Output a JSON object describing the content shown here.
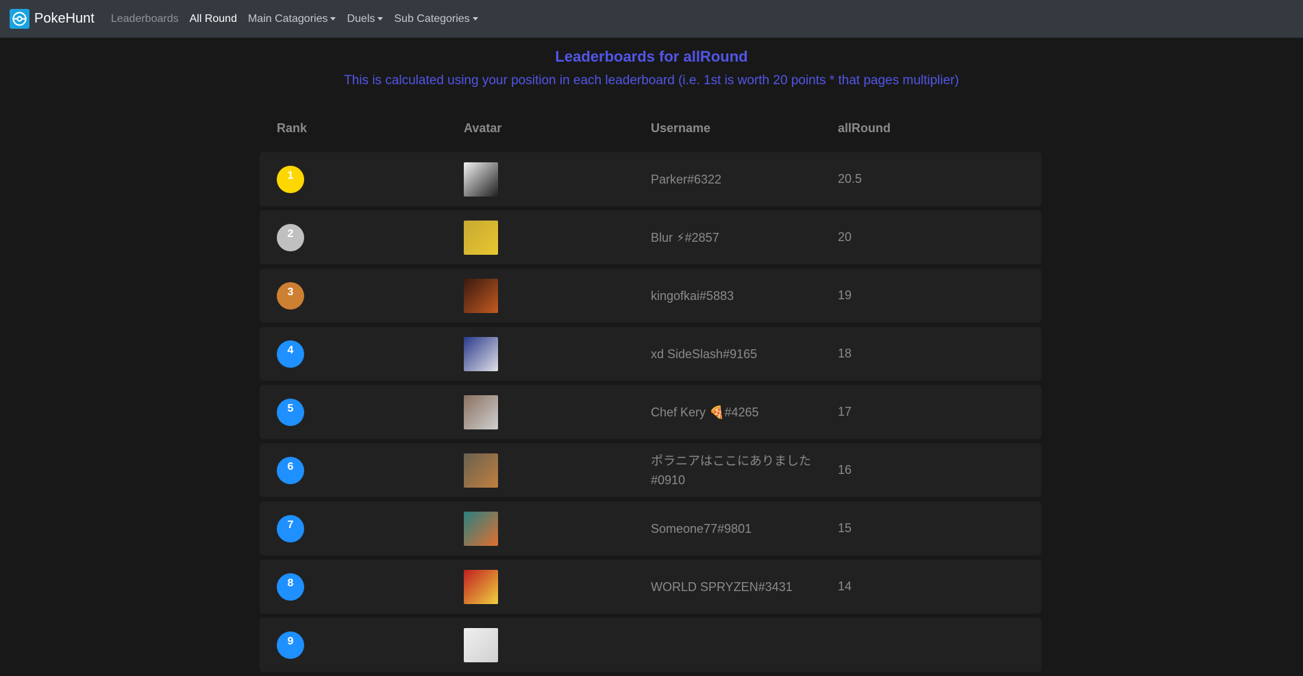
{
  "brand": {
    "name": "PokeHunt"
  },
  "nav": {
    "items": [
      {
        "label": "Leaderboards",
        "state": "muted",
        "dropdown": false
      },
      {
        "label": "All Round",
        "state": "active",
        "dropdown": false
      },
      {
        "label": "Main Catagories",
        "state": "normal",
        "dropdown": true
      },
      {
        "label": "Duels",
        "state": "normal",
        "dropdown": true
      },
      {
        "label": "Sub Categories",
        "state": "normal",
        "dropdown": true
      }
    ]
  },
  "page": {
    "title": "Leaderboards for allRound",
    "subtitle": "This is calculated using your position in each leaderboard (i.e. 1st is worth 20 points * that pages multiplier)"
  },
  "table": {
    "headers": [
      "Rank",
      "Avatar",
      "Username",
      "allRound"
    ],
    "rows": [
      {
        "rank": "1",
        "badge_color": "#ffd700",
        "username": "Parker#6322",
        "score": "20.5",
        "avatar_colors": [
          "#f2f2f2",
          "#202020"
        ]
      },
      {
        "rank": "2",
        "badge_color": "#c0c0c0",
        "username": "Blur ⚡#2857",
        "score": "20",
        "avatar_colors": [
          "#c8a832",
          "#e8c830"
        ]
      },
      {
        "rank": "3",
        "badge_color": "#cd7f32",
        "username": "kingofkai#5883",
        "score": "19",
        "avatar_colors": [
          "#3a1a10",
          "#c45a20"
        ]
      },
      {
        "rank": "4",
        "badge_color": "#1e90ff",
        "username": "xd SideSlash#9165",
        "score": "18",
        "avatar_colors": [
          "#2a3a8a",
          "#e0e0e8"
        ]
      },
      {
        "rank": "5",
        "badge_color": "#1e90ff",
        "username": "Chef Kery 🍕#4265",
        "score": "17",
        "avatar_colors": [
          "#8a7060",
          "#d0d0d0"
        ]
      },
      {
        "rank": "6",
        "badge_color": "#1e90ff",
        "username": "ポラニアはここにありました#0910",
        "score": "16",
        "avatar_colors": [
          "#6a6050",
          "#c08040"
        ]
      },
      {
        "rank": "7",
        "badge_color": "#1e90ff",
        "username": "Someone77#9801",
        "score": "15",
        "avatar_colors": [
          "#2a8080",
          "#e07030"
        ]
      },
      {
        "rank": "8",
        "badge_color": "#1e90ff",
        "username": "WORLD SPRYZEN#3431",
        "score": "14",
        "avatar_colors": [
          "#c02020",
          "#f0d040"
        ]
      },
      {
        "rank": "9",
        "badge_color": "#1e90ff",
        "username": "",
        "score": "",
        "avatar_colors": [
          "#f0f0f0",
          "#d0d0d0"
        ]
      }
    ]
  }
}
